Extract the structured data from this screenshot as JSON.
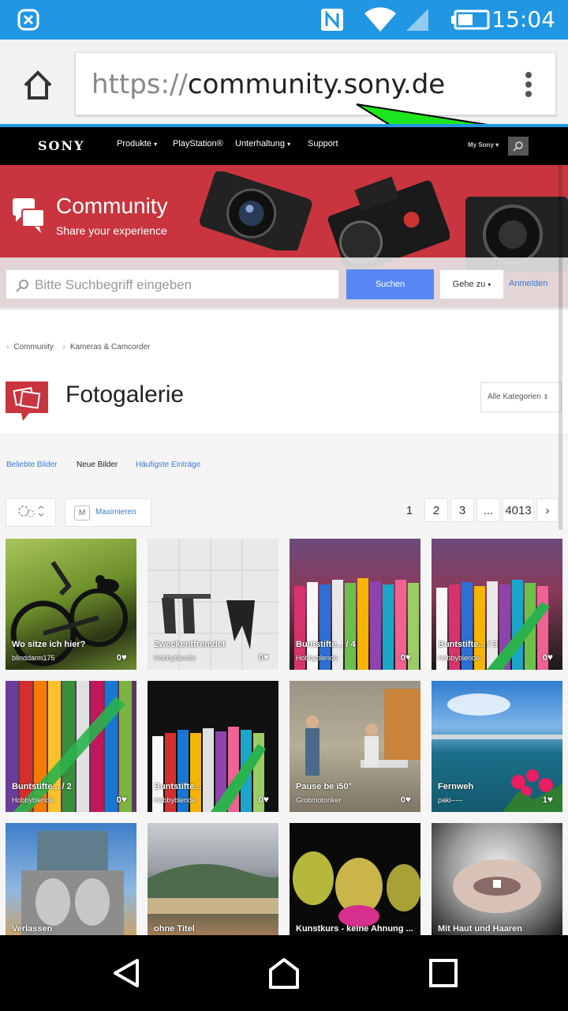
{
  "status_bar": {
    "time": "15:04",
    "icons": [
      "app-notification-icon",
      "nfc-icon",
      "wifi-icon",
      "cell-signal-icon",
      "battery-icon"
    ]
  },
  "browser": {
    "url_scheme": "https://",
    "url_host": "community.sony.de",
    "menu_icon": "overflow-menu-icon",
    "home_icon": "home-icon"
  },
  "sony_nav": {
    "logo": "SONY",
    "items": [
      "Produkte",
      "PlayStation®",
      "Unterhaltung",
      "Support"
    ],
    "my_sony": "My Sony"
  },
  "banner": {
    "title": "Community",
    "subtitle": "Share your experience"
  },
  "search": {
    "placeholder": "Bitte Suchbegriff eingeben",
    "button": "Suchen",
    "goto": "Gehe zu",
    "login": "Anmelden"
  },
  "breadcrumb": [
    "Community",
    "Kameras & Camcorder"
  ],
  "page": {
    "title": "Fotogalerie",
    "category_select": "Alle Kategorien"
  },
  "tabs": [
    "Beliebte Bilder",
    "Neue Bilder",
    "Häufigste Einträge"
  ],
  "toolbar": {
    "maximize_key": "M",
    "maximize_label": "Maximieren"
  },
  "pagination": [
    "1",
    "2",
    "3",
    "...",
    "4013",
    "›"
  ],
  "gallery": [
    {
      "title": "Wo sitze ich hier?",
      "author": "blinddarm175",
      "likes": "0"
    },
    {
      "title": "Zweckentfremdet",
      "author": "Hobbyblende",
      "likes": "0"
    },
    {
      "title": "Buntstifte... / 4",
      "author": "Hobbyblende",
      "likes": "0"
    },
    {
      "title": "Buntstifte... / 3",
      "author": "Hobbyblende",
      "likes": "0"
    },
    {
      "title": "Buntstifte... / 2",
      "author": "Hobbyblende",
      "likes": "0"
    },
    {
      "title": "Buntstifte...",
      "author": "Hobbyblende",
      "likes": "0"
    },
    {
      "title": "Pause be i50°",
      "author": "Grobmotoriker",
      "likes": "0"
    },
    {
      "title": "Fernweh",
      "author": "paki-----",
      "likes": "1"
    },
    {
      "title": "Verlassen",
      "author": "",
      "likes": ""
    },
    {
      "title": "ohne Titel",
      "author": "",
      "likes": ""
    },
    {
      "title": "Kunstkurs - keine Ahnung ...",
      "author": "",
      "likes": ""
    },
    {
      "title": "Mit Haut und Haaren",
      "author": "",
      "likes": ""
    }
  ]
}
